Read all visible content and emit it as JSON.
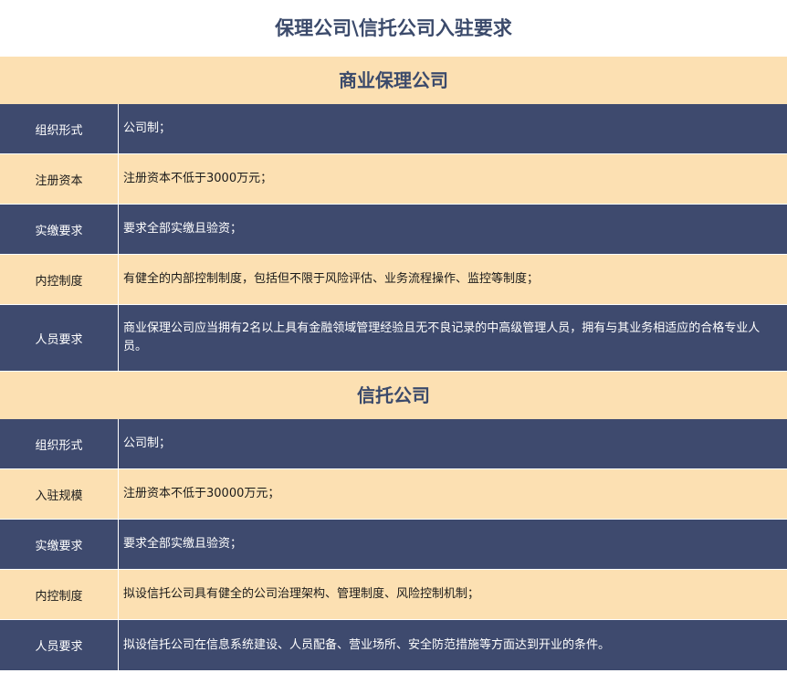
{
  "title": "保理公司\\信托公司入驻要求",
  "sections": [
    {
      "header": "商业保理公司",
      "rows": [
        {
          "label": "组织形式",
          "value": "公司制；"
        },
        {
          "label": "注册资本",
          "value": "注册资本不低于3000万元；"
        },
        {
          "label": "实缴要求",
          "value": "要求全部实缴且验资；"
        },
        {
          "label": "内控制度",
          "value": "有健全的内部控制制度，包括但不限于风险评估、业务流程操作、监控等制度；"
        },
        {
          "label": "人员要求",
          "value": "商业保理公司应当拥有2名以上具有金融领域管理经验且无不良记录的中高级管理人员，拥有与其业务相适应的合格专业人员。"
        }
      ]
    },
    {
      "header": "信托公司",
      "rows": [
        {
          "label": "组织形式",
          "value": "公司制；"
        },
        {
          "label": "入驻规模",
          "value": "注册资本不低于30000万元；"
        },
        {
          "label": "实缴要求",
          "value": "要求全部实缴且验资；"
        },
        {
          "label": "内控制度",
          "value": "拟设信托公司具有健全的公司治理架构、管理制度、风险控制机制；"
        },
        {
          "label": "人员要求",
          "value": "拟设信托公司在信息系统建设、人员配备、营业场所、安全防范措施等方面达到开业的条件。"
        }
      ]
    }
  ],
  "colors": {
    "dark_row": "#3e4a6e",
    "light_row": "#fce0b2",
    "title_text": "#3b4a6b"
  }
}
